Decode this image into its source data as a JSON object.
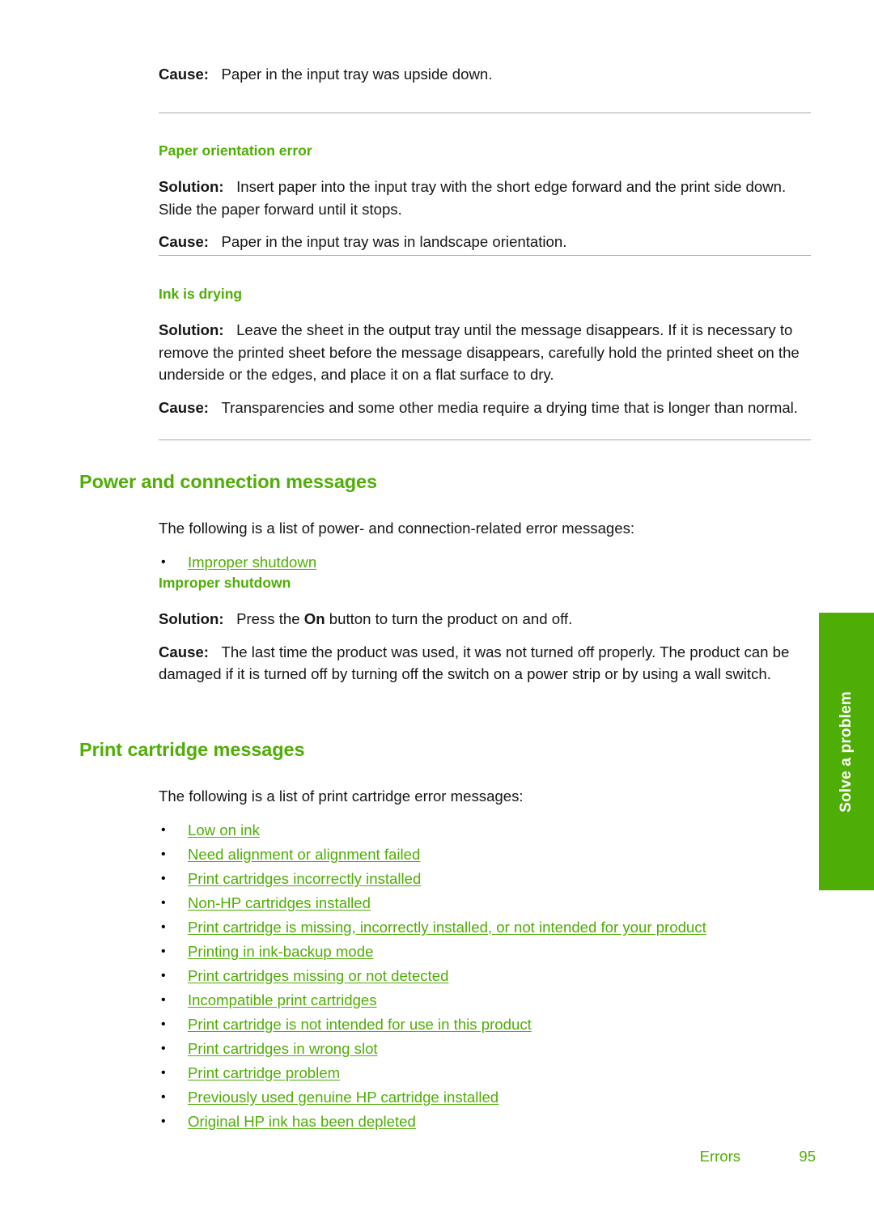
{
  "colors": {
    "accent_green": "#4fae05",
    "rule_gray": "#a6a8ab",
    "body_text": "#161616",
    "tab_text": "#ffffff"
  },
  "blocks": {
    "top_cause": {
      "label": "Cause:",
      "text": "Paper in the input tray was upside down."
    },
    "paper_orientation_error": {
      "heading": "Paper orientation error",
      "solution_label": "Solution:",
      "solution_text": "Insert paper into the input tray with the short edge forward and the print side down. Slide the paper forward until it stops.",
      "cause_label": "Cause:",
      "cause_text": "Paper in the input tray was in landscape orientation."
    },
    "ink_is_drying": {
      "heading": "Ink is drying",
      "solution_label": "Solution:",
      "solution_text": "Leave the sheet in the output tray until the message disappears. If it is necessary to remove the printed sheet before the message disappears, carefully hold the printed sheet on the underside or the edges, and place it on a flat surface to dry.",
      "cause_label": "Cause:",
      "cause_text": "Transparencies and some other media require a drying time that is longer than normal."
    },
    "power_and_connection": {
      "heading": "Power and connection messages",
      "intro": "The following is a list of power- and connection-related error messages:",
      "links": [
        "Improper shutdown"
      ]
    },
    "improper_shutdown": {
      "heading": "Improper shutdown",
      "solution_label": "Solution:",
      "solution_text_before": "Press the ",
      "solution_bold": "On",
      "solution_text_after": " button to turn the product on and off.",
      "cause_label": "Cause:",
      "cause_text": "The last time the product was used, it was not turned off properly. The product can be damaged if it is turned off by turning off the switch on a power strip or by using a wall switch."
    },
    "print_cartridge_messages": {
      "heading": "Print cartridge messages",
      "intro": "The following is a list of print cartridge error messages:",
      "links": [
        "Low on ink",
        "Need alignment or alignment failed",
        "Print cartridges incorrectly installed",
        "Non-HP cartridges installed",
        "Print cartridge is missing, incorrectly installed, or not intended for your product",
        "Printing in ink-backup mode",
        "Print cartridges missing or not detected",
        "Incompatible print cartridges",
        "Print cartridge is not intended for use in this product",
        "Print cartridges in wrong slot",
        "Print cartridge problem",
        "Previously used genuine HP cartridge installed",
        "Original HP ink has been depleted"
      ]
    }
  },
  "side_tab": {
    "label": "Solve a problem"
  },
  "footer": {
    "chapter": "Errors",
    "page_number": "95"
  },
  "bullet_glyph": "•"
}
